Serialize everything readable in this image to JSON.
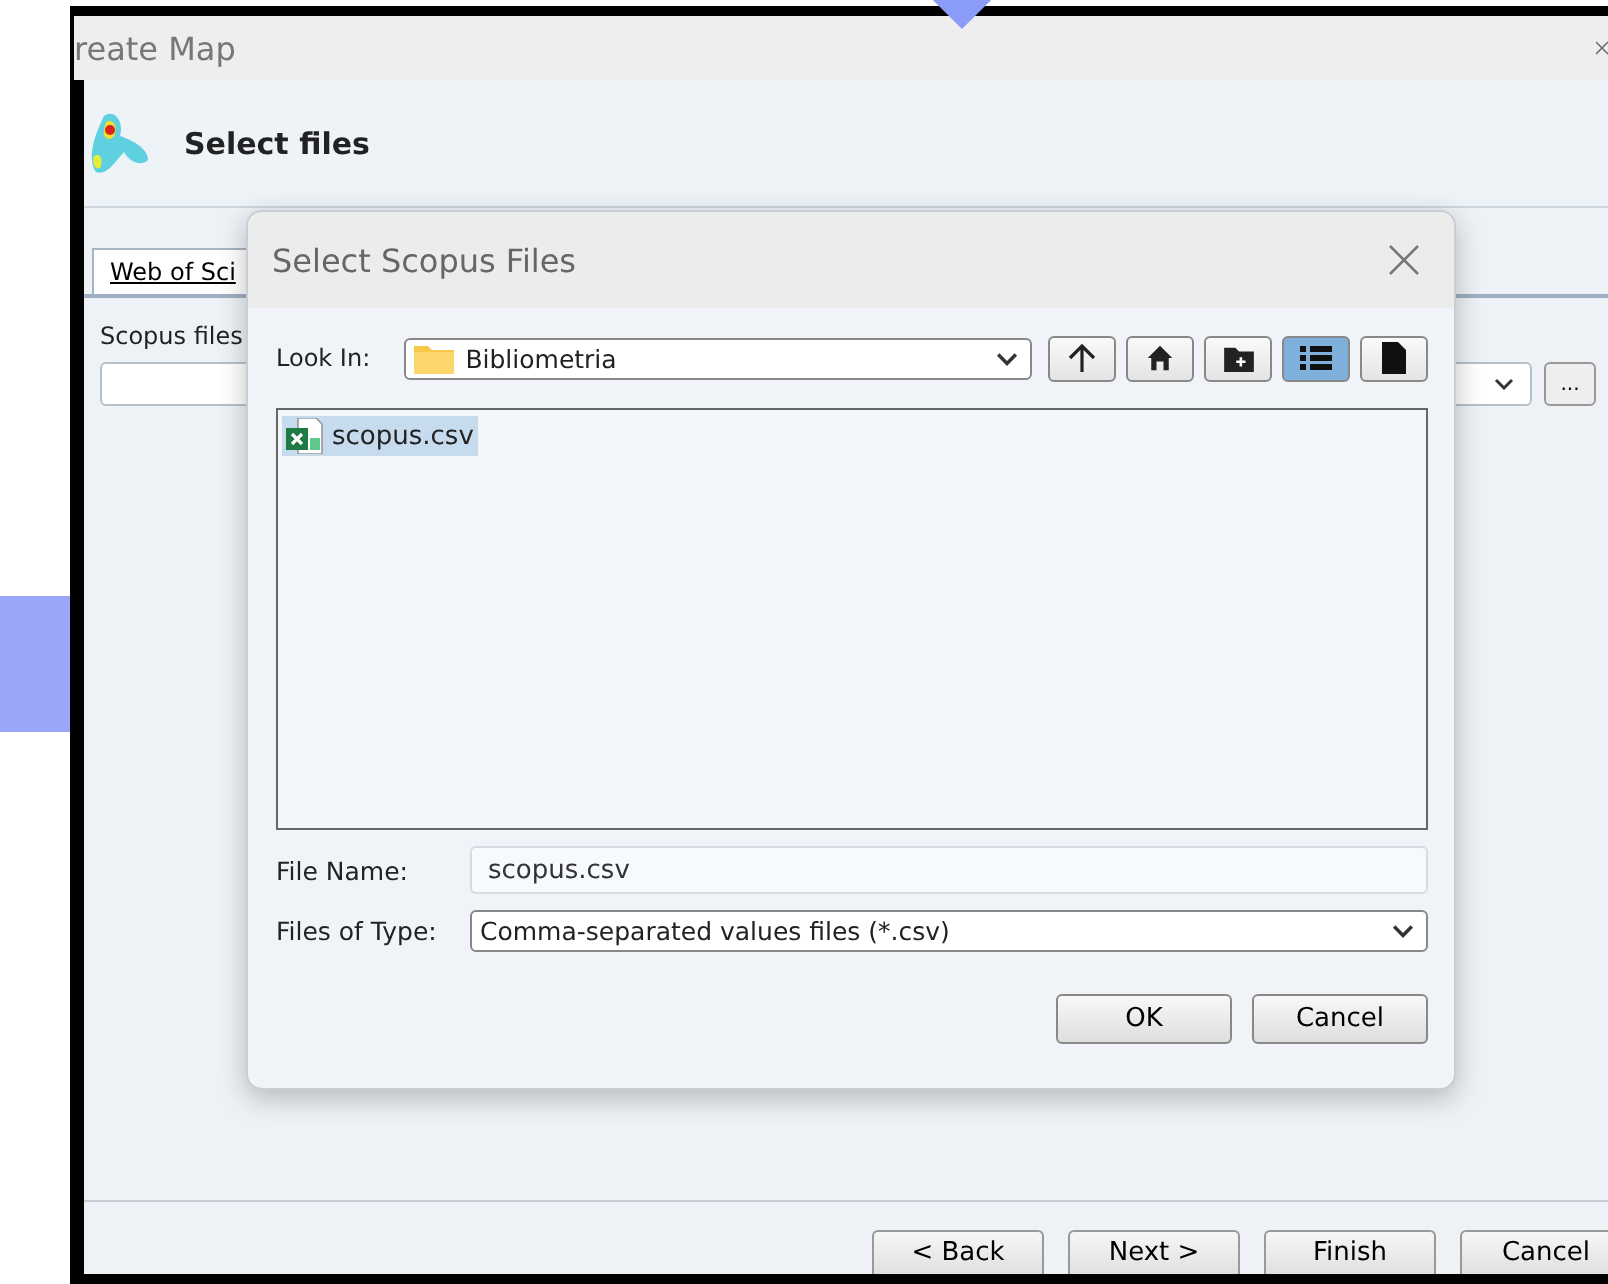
{
  "window": {
    "title": "reate Map"
  },
  "header": {
    "title": "Select files"
  },
  "tabs": [
    {
      "label": "Web of Sci",
      "selected": true
    }
  ],
  "scopus_files": {
    "label": "Scopus files",
    "browse": "..."
  },
  "dialog": {
    "title": "Select Scopus Files",
    "look_in_label": "Look In:",
    "look_in_value": "Bibliometria",
    "toolbar": [
      {
        "kind": "up",
        "selected": false
      },
      {
        "kind": "home",
        "selected": false
      },
      {
        "kind": "new-folder",
        "selected": false
      },
      {
        "kind": "list",
        "selected": true
      },
      {
        "kind": "details",
        "selected": false
      }
    ],
    "files": [
      {
        "name": "scopus.csv",
        "selected": true
      }
    ],
    "file_name_label": "File Name:",
    "file_name_value": "scopus.csv",
    "file_type_label": "Files of Type:",
    "file_type_value": "Comma-separated values files (*.csv)",
    "buttons": [
      "OK",
      "Cancel"
    ]
  },
  "buttons": [
    "< Back",
    "Next >",
    "Finish",
    "Cancel"
  ]
}
